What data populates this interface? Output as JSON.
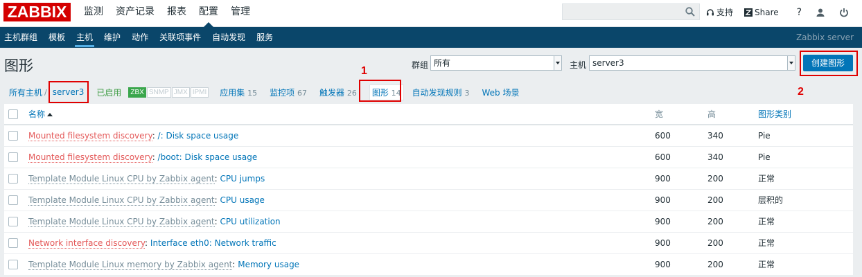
{
  "logo": "ZABBIX",
  "main_nav": [
    "监测",
    "资产记录",
    "报表",
    "配置",
    "管理"
  ],
  "main_nav_active": "配置",
  "tools": {
    "support": "支持",
    "share": "Share",
    "help": "?"
  },
  "sub_nav": [
    "主机群组",
    "模板",
    "主机",
    "维护",
    "动作",
    "关联项事件",
    "自动发现",
    "服务"
  ],
  "sub_nav_active": "主机",
  "server_name": "Zabbix server",
  "page_title": "图形",
  "filter": {
    "group_label": "群组",
    "group_value": "所有",
    "host_label": "主机",
    "host_value": "server3"
  },
  "create_button": "创建图形",
  "annotations": {
    "one": "1",
    "two": "2"
  },
  "breadcrumb": {
    "all_hosts": "所有主机",
    "separator": "/",
    "host": "server3",
    "status": "已启用",
    "badges": [
      "ZBX",
      "SNMP",
      "JMX",
      "IPMI"
    ],
    "tabs": [
      {
        "label": "应用集",
        "count": "15"
      },
      {
        "label": "监控项",
        "count": "67"
      },
      {
        "label": "触发器",
        "count": "26"
      },
      {
        "label": "图形",
        "count": "14"
      },
      {
        "label": "自动发现规则",
        "count": "3"
      },
      {
        "label": "Web 场景",
        "count": ""
      }
    ]
  },
  "table": {
    "headers": {
      "name": "名称",
      "width": "宽",
      "height": "高",
      "type": "图形类别"
    },
    "rows": [
      {
        "prefix": "Mounted filesystem discovery",
        "prefix_style": "red",
        "name": "/: Disk space usage",
        "width": "600",
        "height": "340",
        "type": "Pie"
      },
      {
        "prefix": "Mounted filesystem discovery",
        "prefix_style": "red",
        "name": "/boot: Disk space usage",
        "width": "600",
        "height": "340",
        "type": "Pie"
      },
      {
        "prefix": "Template Module Linux CPU by Zabbix agent",
        "prefix_style": "gray",
        "name": "CPU jumps",
        "width": "900",
        "height": "200",
        "type": "正常"
      },
      {
        "prefix": "Template Module Linux CPU by Zabbix agent",
        "prefix_style": "gray",
        "name": "CPU usage",
        "width": "900",
        "height": "200",
        "type": "层积的"
      },
      {
        "prefix": "Template Module Linux CPU by Zabbix agent",
        "prefix_style": "gray",
        "name": "CPU utilization",
        "width": "900",
        "height": "200",
        "type": "正常"
      },
      {
        "prefix": "Network interface discovery",
        "prefix_style": "red",
        "name": "Interface eth0: Network traffic",
        "width": "900",
        "height": "200",
        "type": "正常"
      },
      {
        "prefix": "Template Module Linux memory by Zabbix agent",
        "prefix_style": "gray",
        "name": "Memory usage",
        "width": "900",
        "height": "200",
        "type": "正常"
      }
    ]
  }
}
